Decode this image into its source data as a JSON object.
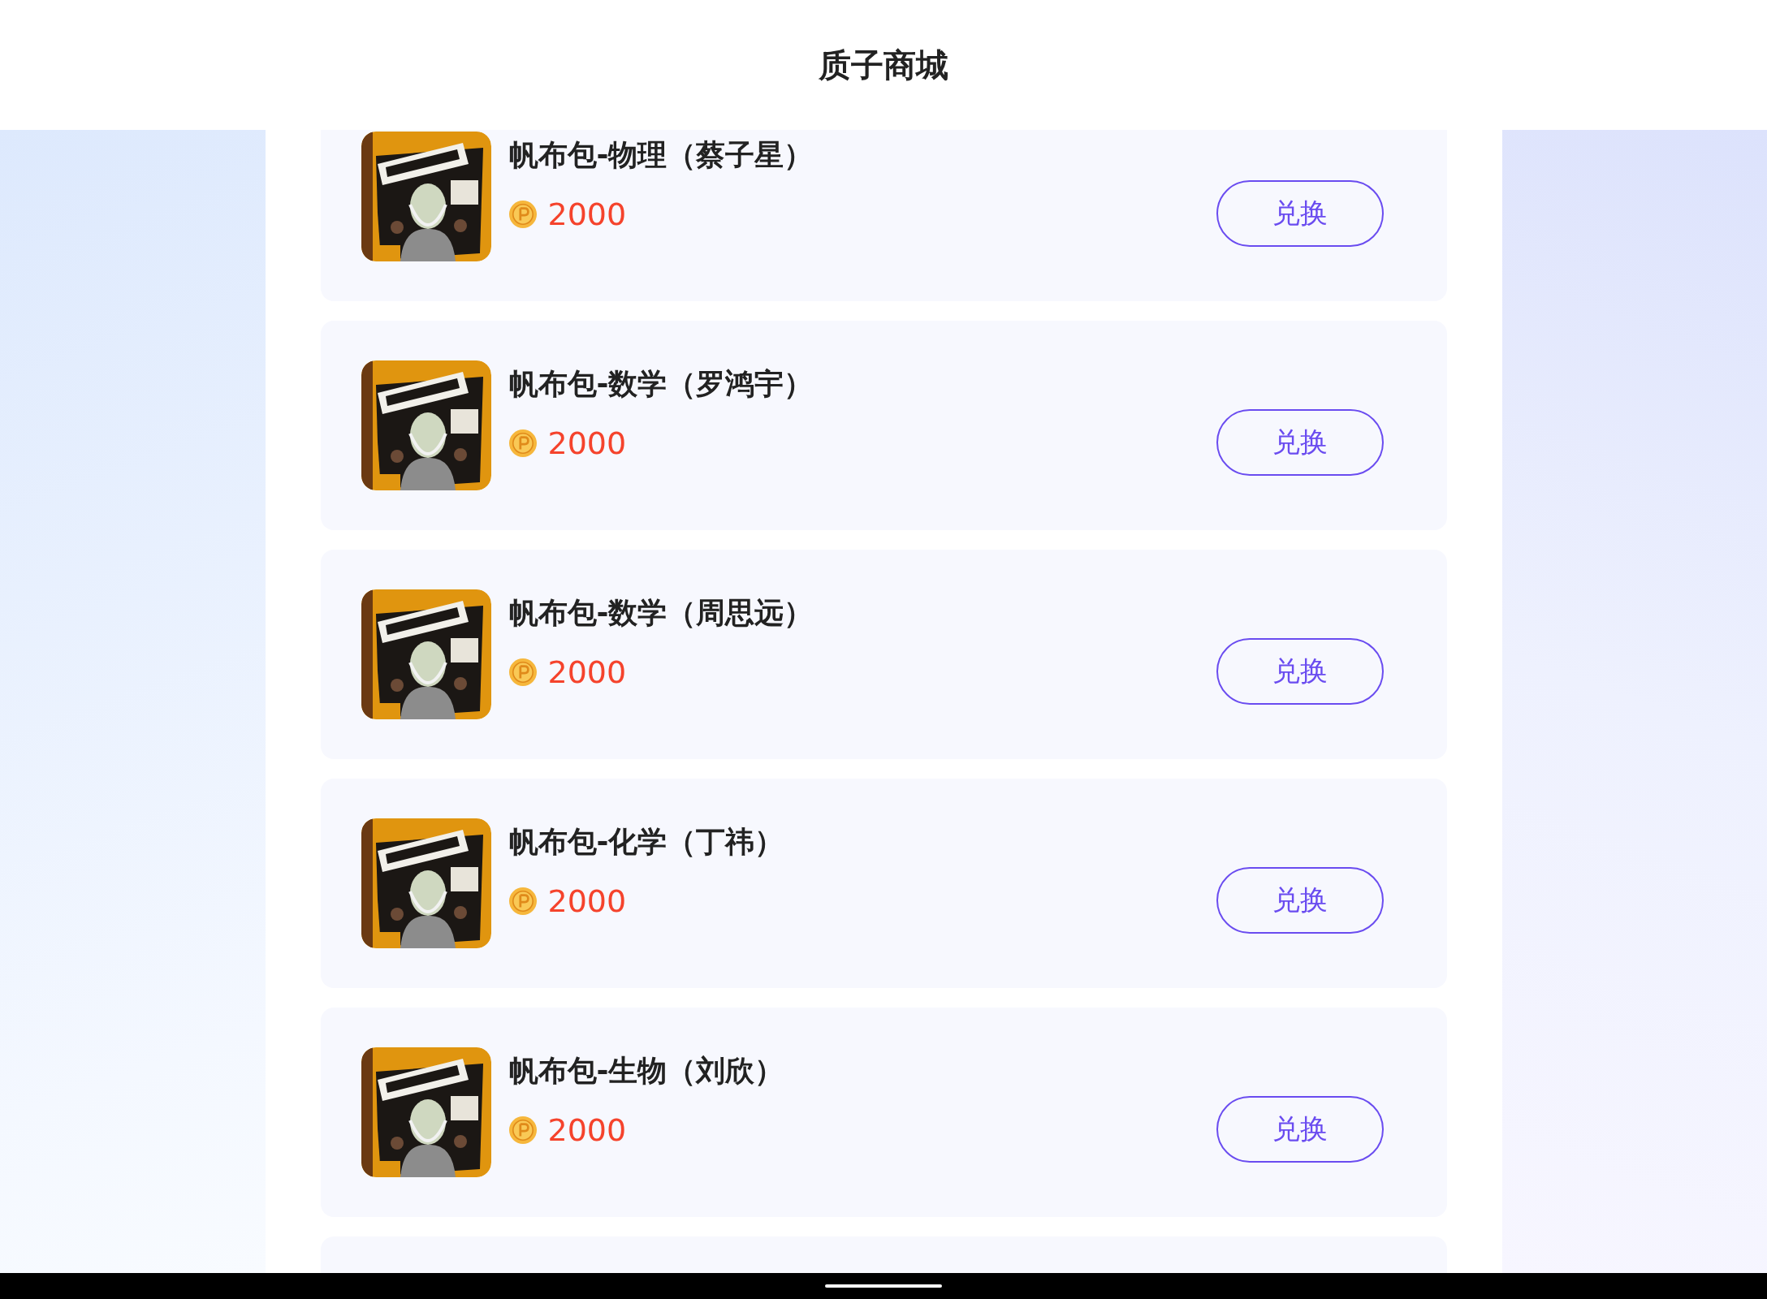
{
  "header": {
    "title": "质子商城"
  },
  "products": [
    {
      "name": "帆布包-物理（蔡子星）",
      "price": "2000",
      "button": "兑换"
    },
    {
      "name": "帆布包-数学（罗鸿宇）",
      "price": "2000",
      "button": "兑换"
    },
    {
      "name": "帆布包-数学（周思远）",
      "price": "2000",
      "button": "兑换"
    },
    {
      "name": "帆布包-化学（丁祎）",
      "price": "2000",
      "button": "兑换"
    },
    {
      "name": "帆布包-生物（刘欣）",
      "price": "2000",
      "button": "兑换"
    }
  ]
}
